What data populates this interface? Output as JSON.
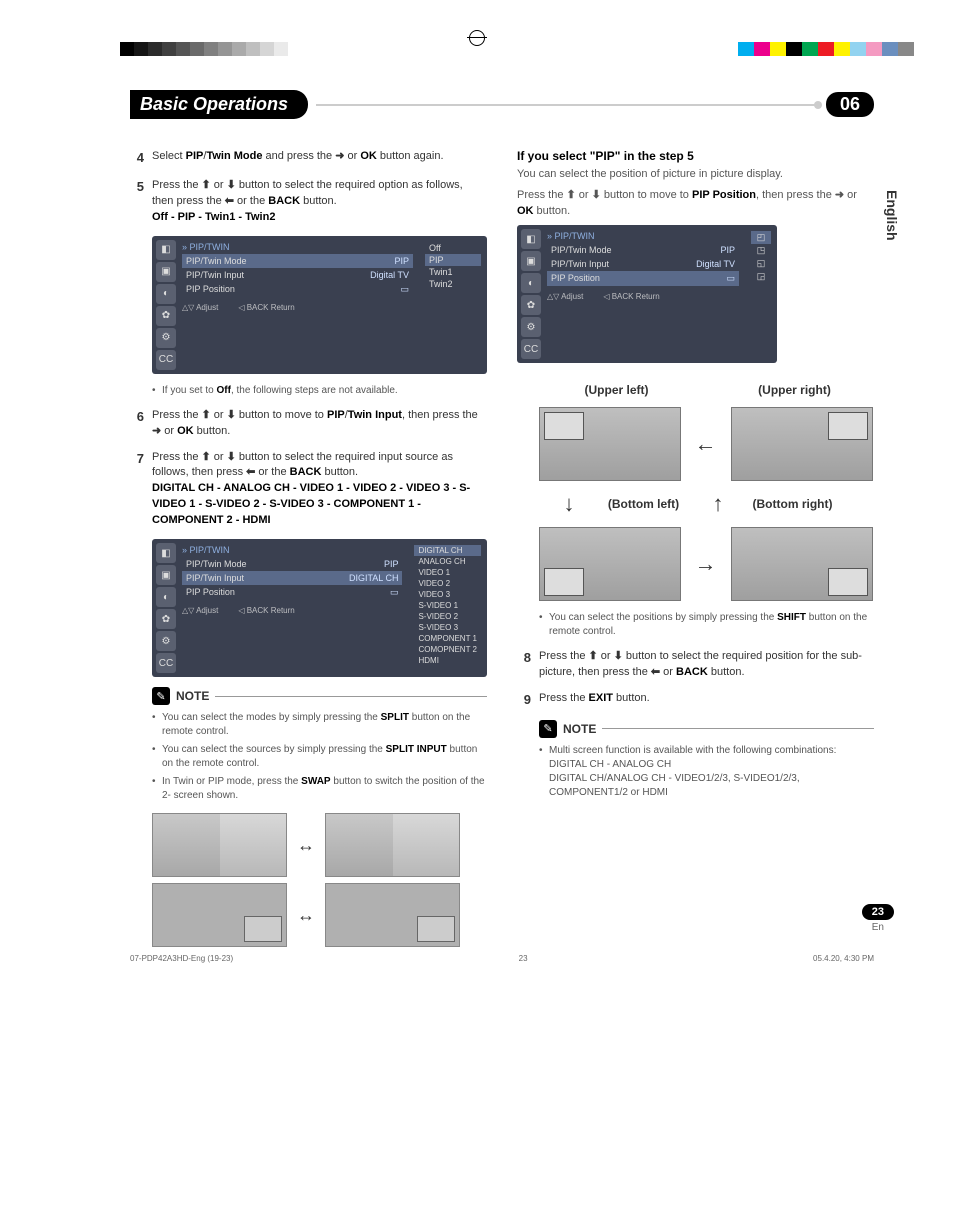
{
  "header": {
    "title": "Basic Operations",
    "chapter": "06"
  },
  "side_tab": "English",
  "left": {
    "step4": {
      "num": "4",
      "text_a": "Select ",
      "b1": "PIP",
      "slash": "/",
      "b2": "Twin Mode",
      "text_b": " and press the ",
      "arrow": "➜",
      "text_c": " or ",
      "b3": "OK",
      "text_d": " button again."
    },
    "step5": {
      "num": "5",
      "text_a": "Press the ",
      "up": "⬆",
      "text_b": " or ",
      "down": "⬇",
      "text_c": " button to select the required option as follows, then press the ",
      "left": "⬅",
      "text_d": " or the ",
      "back": "BACK",
      "text_e": " button.",
      "options": "Off  - PIP - Twin1 - Twin2"
    },
    "osd1": {
      "title": "PIP/TWIN",
      "rows": [
        {
          "label": "PIP/Twin Mode",
          "value": "PIP"
        },
        {
          "label": "PIP/Twin Input",
          "value": "Digital TV"
        },
        {
          "label": "PIP Position",
          "value": "▭"
        }
      ],
      "popup": [
        "Off",
        "PIP",
        "Twin1",
        "Twin2"
      ],
      "popup_selected": 1,
      "adjust": "Adjust",
      "return": "Return"
    },
    "bullet_off": "If you set to Off, the following steps are not available.",
    "step6": {
      "num": "6",
      "text_a": "Press the ",
      "up": "⬆",
      "text_b": " or ",
      "down": "⬇",
      "text_c": " button to move to ",
      "b1": "PIP",
      "slash": "/",
      "b2": "Twin Input",
      "text_d": ", then press the ",
      "arrow": "➜",
      "text_e": " or ",
      "ok": "OK",
      "text_f": " button."
    },
    "step7": {
      "num": "7",
      "text_a": "Press the ",
      "up": "⬆",
      "text_b": " or ",
      "down": "⬇",
      "text_c": " button to select the required input source as follows, then press ",
      "left": "⬅",
      "text_d": " or the ",
      "back": "BACK",
      "text_e": " button.",
      "sources": "DIGITAL CH - ANALOG CH - VIDEO 1 - VIDEO 2 - VIDEO 3 - S-VIDEO 1 - S-VIDEO 2 - S-VIDEO 3 - COMPONENT 1 - COMPONENT 2 - HDMI"
    },
    "osd2": {
      "title": "PIP/TWIN",
      "rows": [
        {
          "label": "PIP/Twin Mode",
          "value": "PIP"
        },
        {
          "label": "PIP/Twin Input",
          "value": "DIGITAL CH"
        },
        {
          "label": "PIP Position",
          "value": "▭"
        }
      ],
      "popup": [
        "DIGITAL CH",
        "ANALOG CH",
        "VIDEO 1",
        "VIDEO 2",
        "VIDEO 3",
        "S-VIDEO 1",
        "S-VIDEO 2",
        "S-VIDEO 3",
        "COMPONENT 1",
        "COMOPNENT 2",
        "HDMI"
      ],
      "popup_selected": 0,
      "adjust": "Adjust",
      "return": "Return"
    },
    "note_label": "NOTE",
    "note_items": [
      {
        "a": "You can select the modes by simply pressing the ",
        "b": "SPLIT",
        "c": " button on the remote control."
      },
      {
        "a": "You can select the sources by simply pressing the ",
        "b": "SPLIT INPUT",
        "c": " button on the remote control."
      },
      {
        "a": "In Twin or PIP mode, press the ",
        "b": "SWAP",
        "c": " button to switch the position of the 2- screen shown."
      }
    ]
  },
  "right": {
    "heading": "If you select \"PIP\" in the step 5",
    "intro": "You can select the position of picture in picture display.",
    "press": {
      "a": "Press the ",
      "up": "⬆",
      "b": " or ",
      "down": "⬇",
      "c": " button to move to ",
      "bold": "PIP Position",
      "d": ", then press the ",
      "arrow": "➜",
      "e": " or ",
      "ok": "OK",
      "f": " button."
    },
    "osd3": {
      "title": "PIP/TWIN",
      "rows": [
        {
          "label": "PIP/Twin Mode",
          "value": "PIP"
        },
        {
          "label": "PIP/Twin Input",
          "value": "Digital TV"
        },
        {
          "label": "PIP Position",
          "value": "▭"
        }
      ],
      "adjust": "Adjust",
      "return": "Return"
    },
    "pos": {
      "ul": "(Upper left)",
      "ur": "(Upper right)",
      "bl": "(Bottom left)",
      "br": "(Bottom right)"
    },
    "note_shift": {
      "a": "You can select the positions by simply pressing the ",
      "b": "SHIFT",
      "c": " button on the remote control."
    },
    "step8": {
      "num": "8",
      "text_a": "Press the ",
      "up": "⬆",
      "text_b": " or ",
      "down": "⬇",
      "text_c": " button to select the required position for the sub-picture, then press the ",
      "left": "⬅",
      "text_d": " or ",
      "back": "BACK",
      "text_e": " button."
    },
    "step9": {
      "num": "9",
      "text_a": "Press the ",
      "b": "EXIT",
      "text_b": " button."
    },
    "note_label": "NOTE",
    "note2_a": "Multi screen function is available with the following combinations:",
    "note2_b": "DIGITAL CH - ANALOG CH",
    "note2_c": "DIGITAL CH/ANALOG CH - VIDEO1/2/3, S-VIDEO1/2/3, COMPONENT1/2 or HDMI"
  },
  "page_num": "23",
  "page_en": "En",
  "footer": {
    "left": "07-PDP42A3HD-Eng (19-23)",
    "mid": "23",
    "right": "05.4.20, 4:30 PM"
  }
}
